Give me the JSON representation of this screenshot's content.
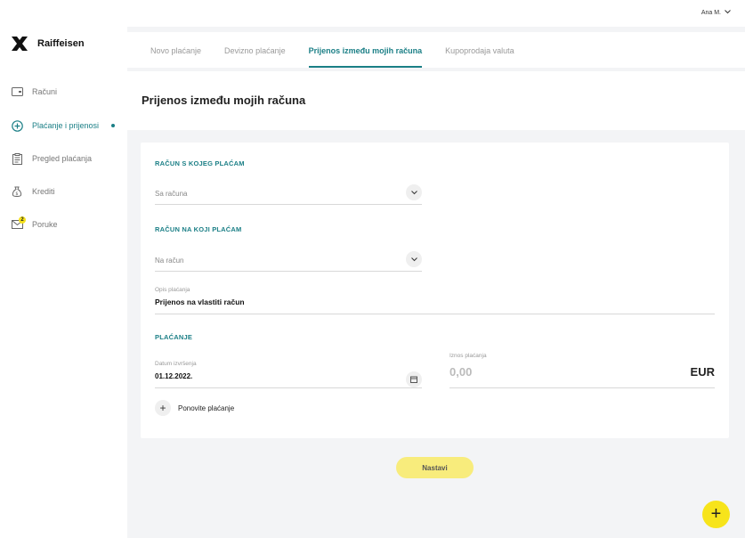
{
  "brand": {
    "name": "Raiffeisen"
  },
  "user": {
    "name": "Ana M."
  },
  "sidebar": {
    "items": [
      {
        "label": "Računi",
        "icon": "wallet-icon"
      },
      {
        "label": "Plaćanje i prijenosi",
        "icon": "plus-circle-icon",
        "active": true
      },
      {
        "label": "Pregled plaćanja",
        "icon": "document-icon"
      },
      {
        "label": "Krediti",
        "icon": "money-bag-icon"
      },
      {
        "label": "Poruke",
        "icon": "mail-icon",
        "badge": "2"
      }
    ]
  },
  "tabs": [
    {
      "label": "Novo plaćanje"
    },
    {
      "label": "Devizno plaćanje"
    },
    {
      "label": "Prijenos između mojih računa",
      "active": true
    },
    {
      "label": "Kupoprodaja valuta"
    }
  ],
  "page": {
    "title": "Prijenos između mojih računa"
  },
  "form": {
    "from_section": "RAČUN S KOJEG PLAĆAM",
    "from_placeholder": "Sa računa",
    "to_section": "RAČUN NA KOJI PLAĆAM",
    "to_placeholder": "Na račun",
    "description_label": "Opis plaćanja",
    "description_value": "Prijenos na vlastiti račun",
    "payment_section": "PLAĆANJE",
    "date_label": "Datum izvršenja",
    "date_value": "01.12.2022.",
    "amount_label": "Iznos plaćanja",
    "amount_value": "0,00",
    "currency": "EUR",
    "repeat_label": "Ponovite plaćanje"
  },
  "actions": {
    "continue_label": "Nastavi",
    "fab_symbol": "+"
  },
  "colors": {
    "accent": "#1b7f86",
    "brand_yellow": "#f7e41b",
    "button_yellow": "#f8ec7c"
  }
}
